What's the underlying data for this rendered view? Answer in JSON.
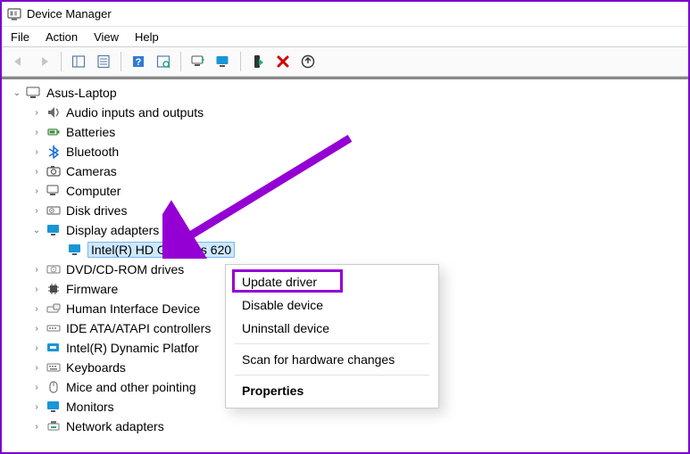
{
  "window": {
    "title": "Device Manager"
  },
  "menu": {
    "file": "File",
    "action": "Action",
    "view": "View",
    "help": "Help"
  },
  "tree": {
    "root": "Asus-Laptop",
    "items": [
      "Audio inputs and outputs",
      "Batteries",
      "Bluetooth",
      "Cameras",
      "Computer",
      "Disk drives",
      "Display adapters",
      "DVD/CD-ROM drives",
      "Firmware",
      "Human Interface Device",
      "IDE ATA/ATAPI controllers",
      "Intel(R) Dynamic Platfor",
      "Keyboards",
      "Mice and other pointing",
      "Monitors",
      "Network adapters"
    ],
    "display_child": "Intel(R) HD Graphics 620"
  },
  "context_menu": {
    "update": "Update driver",
    "disable": "Disable device",
    "uninstall": "Uninstall device",
    "scan": "Scan for hardware changes",
    "properties": "Properties"
  }
}
